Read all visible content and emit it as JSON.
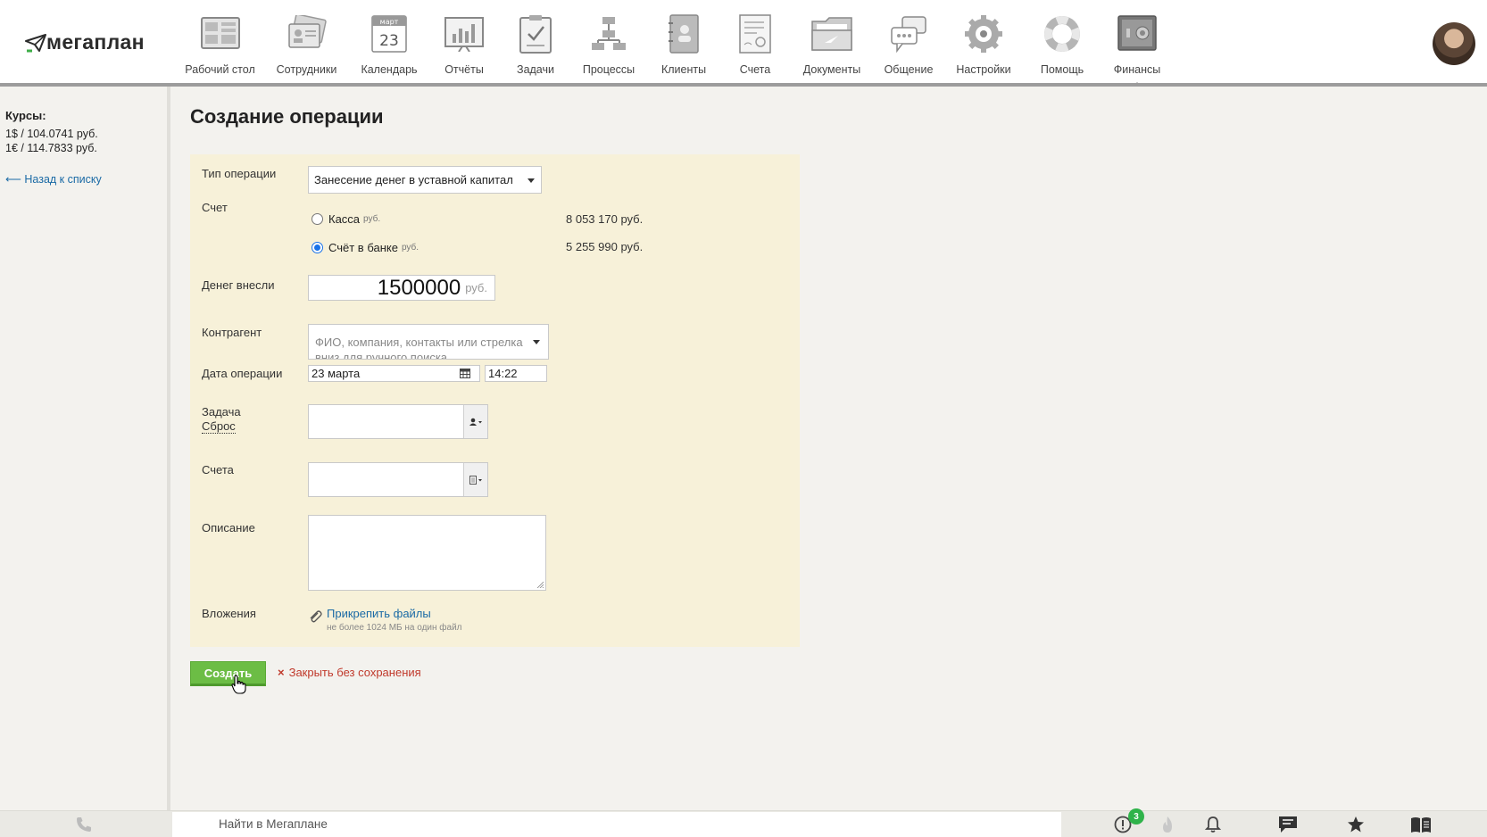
{
  "header": {
    "logo_text": "мегаплан",
    "nav": [
      {
        "label": "Рабочий стол",
        "icon": "desktop-icon"
      },
      {
        "label": "Сотрудники",
        "icon": "employees-icon"
      },
      {
        "label": "Календарь",
        "icon": "calendar-icon",
        "cal_month": "март",
        "cal_day": "23"
      },
      {
        "label": "Отчёты",
        "icon": "reports-icon"
      },
      {
        "label": "Задачи",
        "icon": "tasks-icon"
      },
      {
        "label": "Процессы",
        "icon": "processes-icon"
      },
      {
        "label": "Клиенты",
        "icon": "clients-icon"
      },
      {
        "label": "Счета",
        "icon": "invoices-icon"
      },
      {
        "label": "Документы",
        "icon": "documents-icon"
      },
      {
        "label": "Общение",
        "icon": "chat-icon"
      },
      {
        "label": "Настройки",
        "icon": "settings-icon"
      },
      {
        "label": "Помощь",
        "icon": "help-icon"
      },
      {
        "label": "Финансы",
        "icon": "finance-safe-icon",
        "active": true
      }
    ]
  },
  "sidebar": {
    "rates_title": "Курсы:",
    "rate_usd": "1$ / 104.0741 руб.",
    "rate_eur": "1€ / 114.7833 руб.",
    "back_link": "⟵ Назад к списку"
  },
  "page": {
    "title": "Создание операции"
  },
  "form": {
    "operation_type_label": "Тип операции",
    "operation_type_value": "Занесение денег в уставной капитал",
    "account_label": "Счет",
    "accounts": [
      {
        "name": "Касса",
        "currency": "руб.",
        "amount": "8 053 170 руб.",
        "selected": false
      },
      {
        "name": "Счёт в банке",
        "currency": "руб.",
        "amount": "5 255 990 руб.",
        "selected": true
      }
    ],
    "money_label": "Денег внесли",
    "money_value": "1500000",
    "money_currency": "руб.",
    "contractor_label": "Контрагент",
    "contractor_placeholder": "ФИО, компания, контакты или стрелка вниз для ручного поиска",
    "date_label": "Дата операции",
    "date_value": "23 марта",
    "time_value": "14:22",
    "task_label": "Задача",
    "task_reset": "Сброс",
    "invoices_label": "Счета",
    "description_label": "Описание",
    "attachments_label": "Вложения",
    "attach_link": "Прикрепить файлы",
    "attach_hint": "не более 1024 МБ на один файл"
  },
  "actions": {
    "create_label": "Создать",
    "close_label": "Закрыть без сохранения",
    "close_icon": "×"
  },
  "footer": {
    "search_placeholder": "Найти в Мегаплане",
    "alerts_count": "3"
  },
  "colors": {
    "accent_green": "#6cbd45",
    "link_blue": "#1a6aa5",
    "form_bg": "#f7f1d9",
    "danger_red": "#c0392b"
  }
}
